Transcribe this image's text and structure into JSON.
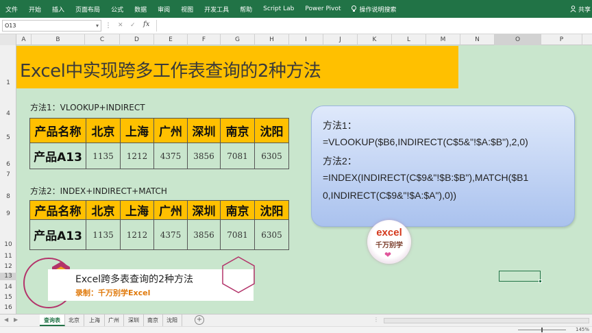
{
  "ribbon": {
    "tabs": [
      "文件",
      "开始",
      "插入",
      "页面布局",
      "公式",
      "数据",
      "审阅",
      "视图",
      "开发工具",
      "帮助",
      "Script Lab",
      "Power Pivot"
    ],
    "tell_me": "操作说明搜索",
    "share": "共享",
    "brand_color": "#217346"
  },
  "formula_bar": {
    "name_box": "O13",
    "fx": "fx",
    "formula": ""
  },
  "columns": [
    "A",
    "B",
    "C",
    "D",
    "E",
    "F",
    "G",
    "H",
    "I",
    "J",
    "K",
    "L",
    "M",
    "N",
    "O",
    "P"
  ],
  "selected_column": "O",
  "rows": [
    "1",
    "4",
    "5",
    "6",
    "7",
    "8",
    "9",
    "10",
    "11",
    "12",
    "13",
    "14",
    "15",
    "16"
  ],
  "selected_row": "13",
  "sheet": {
    "background": "#c9e6cd",
    "banner_title": "Excel中实现跨多工作表查询的2种方法",
    "method1_label": "方法1：VLOOKUP+INDIRECT",
    "method2_label": "方法2：INDEX+INDIRECT+MATCH",
    "tables": [
      {
        "header": [
          "产品名称",
          "北京",
          "上海",
          "广州",
          "深圳",
          "南京",
          "沈阳"
        ],
        "row": [
          "产品A13",
          "1135",
          "1212",
          "4375",
          "3856",
          "7081",
          "6305"
        ]
      },
      {
        "header": [
          "产品名称",
          "北京",
          "上海",
          "广州",
          "深圳",
          "南京",
          "沈阳"
        ],
        "row": [
          "产品A13",
          "1135",
          "1212",
          "4375",
          "3856",
          "7081",
          "6305"
        ]
      }
    ],
    "formula_box": {
      "line1": "方法1：",
      "line2": "=VLOOKUP($B6,INDIRECT(C$5&\"!$A:$B\"),2,0)",
      "line3": "方法2：",
      "line4": "=INDEX(INDIRECT(C$9&\"!$B:$B\"),MATCH($B1",
      "line5": "0,INDIRECT(C$9&\"!$A:$A\"),0))"
    },
    "logo": {
      "word": "excel",
      "tagline": "千万别学"
    },
    "caption": {
      "title": "Excel跨多表查询的2种方法",
      "subtitle": "录制：千万别学Excel"
    }
  },
  "sheet_tabs": [
    "查询表",
    "北京",
    "上海",
    "广州",
    "深圳",
    "南京",
    "沈阳"
  ],
  "active_sheet_tab": "查询表",
  "status_bar": {
    "zoom": "145%"
  }
}
